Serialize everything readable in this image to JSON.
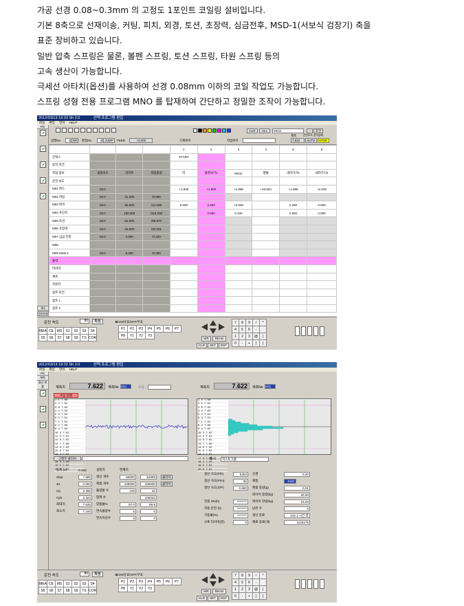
{
  "intro": [
    "가공 선경 0.08~0.3mm 의 고정도 1포인트 코일링 설비입니다.",
    "기본 8축으로 선재이송, 커팅, 피치, 외경, 토션, 초장력, 심금전후, MSD-1(서보식 검장기) 축을",
    "표준 장비하고 있습니다.",
    "일반 압축 스프링은 물론, 볼펜 스프링, 토션 스프링, 타원 스프링 등의",
    "고속 생산이 가능합니다.",
    "극세선 아타치(옵션)를 사용하여 선경 0.08mm 이하의 코일 작업도 가능합니다.",
    "스프링 성형 전용 프로그램 MNO 를 탑재하여 간단하고 정밀한 조작이 가능합니다."
  ],
  "shot1": {
    "title": [
      "2012/03/13 19:23  Sh 3.0",
      "선택 프로그램 편집"
    ],
    "menu": [
      "파일",
      "편집",
      "언어",
      "HELP"
    ],
    "sidebar_top": "PG",
    "side_items": [
      "",
      "",
      "",
      "",
      "",
      ""
    ],
    "side_btn": [
      "계속",
      "정지현재"
    ],
    "toolbar": {
      "jisilno_label": "실행No",
      "jisilno_val": "1",
      "nr": "NR",
      "pyeonjip_label": "편집No",
      "pyeonjip_val": "2",
      "jump": "JUMP",
      "feed_label": "FEED",
      "feed_val": "+0.000",
      "gyeisu_label": "기계위치",
      "jakeop_label": "작업위치",
      "clr": "CLR",
      "all": "ALL",
      "select": "MS11",
      "gyesu": "계측",
      "gyesu_val": "7.622",
      "auto": "AUTO",
      "stop": "STOP",
      "joyeon": "조건",
      "mode_label": "운전모드 동작상태"
    },
    "col_headers": [
      "",
      "",
      "",
      "",
      "1",
      "2",
      "3",
      "4",
      "5",
      "6"
    ],
    "row0": [
      "",
      "설정속도",
      "리미트",
      "작업원점"
    ],
    "rows": [
      {
        "label": "인덱스",
        "s": "",
        "l": "",
        "o": "",
        "c": [
          "START",
          "",
          "",
          "",
          "",
          ""
        ]
      },
      {
        "label": "동작 조건",
        "s": "",
        "l": "",
        "o": "",
        "c": [
          "",
          "",
          "",
          "",
          "",
          ""
        ]
      },
      {
        "label": "작업 정보",
        "s": "설정속도",
        "l": "리미트",
        "o": "작업원점",
        "c": [
          "라",
          "풀라되기1",
          "MS11",
          "평통",
          "내려가기1",
          "내려가기2"
        ]
      },
      {
        "label": "운전 속도",
        "s": "",
        "l": "",
        "o": "",
        "c": [
          "",
          "",
          "",
          "",
          "",
          ""
        ]
      },
      {
        "label": "M01 피드",
        "s": "50.0",
        "l": "",
        "o": "",
        "c": [
          "+1.500",
          "+1.800",
          "+1.898",
          "+43.504",
          "+1.898",
          "+2.029"
        ]
      },
      {
        "label": "M02 커팅",
        "s": "50.0",
        "l": "31.285",
        "o": "/0.000",
        "c": [
          "",
          "",
          "",
          "",
          "",
          ""
        ]
      },
      {
        "label": "M03 피치",
        "s": "50.0",
        "l": "35.000",
        "o": "/14.199",
        "c": [
          "0.000",
          "2.450",
          ">4.029",
          "",
          "2.450",
          "0.000"
        ]
      },
      {
        "label": "M04 포인트",
        "s": "50.0",
        "l": "180.000",
        "o": "/116.000",
        "c": [
          "",
          "0.050",
          "0.100",
          "",
          "0.050",
          "0.000"
        ]
      },
      {
        "label": "M05 토션",
        "s": "50.0",
        "l": "91.000",
        "o": "/90.970",
        "c": [
          "",
          "",
          "",
          "",
          "",
          ""
        ]
      },
      {
        "label": "M06 초장력",
        "s": "50.0",
        "l": "45.000",
        "o": "/22.001",
        "c": [
          "",
          "",
          "",
          "",
          "",
          ""
        ]
      },
      {
        "label": "M07 심금 전후",
        "s": "50.0",
        "l": "4.000",
        "o": "/0.400",
        "c": [
          "",
          "",
          "",
          "",
          "",
          ""
        ]
      },
      {
        "label": "M08",
        "s": "",
        "l": "",
        "o": "",
        "c": [
          "",
          "",
          "",
          "",
          "",
          ""
        ]
      },
      {
        "label": "M09 MSD-1",
        "s": "50.0",
        "l": "5.000",
        "o": "/0.000",
        "c": [
          "",
          "",
          "",
          "",
          "",
          ""
        ]
      },
      {
        "label": "출력",
        "s": "",
        "l": "",
        "o": "",
        "c": [
          "",
          "",
          "",
          "",
          "",
          ""
        ]
      },
      {
        "label": "타이머",
        "s": "",
        "l": "",
        "o": "",
        "c": [
          "",
          "",
          "",
          "",
          "",
          ""
        ]
      },
      {
        "label": "계측",
        "s": "",
        "l": "",
        "o": "",
        "c": [
          "",
          "",
          "",
          "",
          "",
          ""
        ]
      },
      {
        "label": "카운터",
        "s": "",
        "l": "",
        "o": "",
        "c": [
          "",
          "",
          "",
          "",
          "",
          ""
        ]
      },
      {
        "label": "점프 조건",
        "s": "",
        "l": "",
        "o": "",
        "c": [
          "",
          "",
          "",
          "",
          "",
          ""
        ]
      },
      {
        "label": "점프 1",
        "s": "",
        "l": "",
        "o": "",
        "c": [
          "",
          "",
          "",
          "",
          "",
          ""
        ]
      },
      {
        "label": "점프 2",
        "s": "",
        "l": "",
        "o": "",
        "c": [
          "",
          "",
          "",
          "",
          "",
          ""
        ]
      }
    ],
    "speed_label": "운전 속도",
    "speed_val": "80",
    "confirm": "확정",
    "onoff": "ON/유효/OFF/무효",
    "axis_rows": [
      [
        "MEA",
        "CE",
        "MS",
        "S1",
        "S2",
        "S3",
        "S4"
      ],
      [
        "S5",
        "S6",
        "S7",
        "S8",
        "S9",
        "TS",
        "COR"
      ]
    ],
    "p_rows": [
      [
        "P1",
        "P2",
        "P3",
        "P4",
        "P5",
        "P6",
        "P7"
      ],
      [
        "P8",
        "Y1",
        "Y2",
        "Y3",
        "",
        "",
        ""
      ]
    ],
    "jog": [
      "WR",
      "READ",
      "CLR",
      "SET",
      "RST"
    ],
    "keys": [
      [
        "7",
        "8",
        "9",
        "/",
        "*"
      ],
      [
        "4",
        "5",
        "6",
        "-",
        ""
      ],
      [
        "1",
        "2",
        "3",
        "@",
        "|"
      ],
      [
        "0",
        "-",
        "+",
        "]",
        "["
      ]
    ]
  },
  "shot2": {
    "title": [
      "2012/03/13 19:22  Sh 3.0",
      "선택 프로그램 편집"
    ],
    "menu": [
      "파일",
      "편집",
      "언어",
      "HELP"
    ],
    "side_top": [
      "PG",
      "계측",
      "결산 현황"
    ],
    "m1_label": "계측치",
    "m1_val": "7.622",
    "m1_no_label": "계측No",
    "m1_no": "M11",
    "m1_extra": "수동",
    "m2_label": "계측치",
    "m2_val": "7.622",
    "m2_no_label": "계측No",
    "m2_no": "M11",
    "manual_btn": "수동 실행",
    "graph_clear": "그래프 클리어",
    "display_label": "표시",
    "display_val": "히스토그램",
    "list1": [
      "1 1 7.60",
      "2 4 7.61",
      "3 6 7.62",
      "4 4 7.62",
      "5 2 7.61",
      "6 3 7.61",
      "7 1 7.61",
      "8 2 7.60",
      "9 4 7.62",
      "10 3 7.62",
      "11 5 7.61",
      "12 6 7.61",
      "13 7 7.60",
      "14 8 7.62",
      "15 9 7.62",
      "16 2 7.61",
      "17 3 7.60",
      "18 4 7.60",
      "19 5 7.61",
      "20 6 7.61"
    ],
    "list2": [
      "1 4 7.60",
      "2 5 7.61",
      "3 6 7.62",
      "4 4 7.62",
      "5 2 7.61",
      "6 3 7.61",
      "7 1 7.61",
      "8 2 7.60",
      "9 4 7.62",
      "10 3 7.62",
      "11 5 7.61",
      "12 6 7.61",
      "13 7 7.60",
      "14 8 7.62",
      "15 9 7.62",
      "16 2 7.61",
      "17 3 7.60",
      "18 4 7.60",
      "19 5 7.61",
      "20 6 7.61"
    ],
    "stats_left": [
      [
        "공차 (±)",
        "0.150",
        "설정치",
        "현재치"
      ],
      [
        "Xbar",
        "7.596",
        "생산 개수",
        "60000",
        "54999",
        "클리어"
      ],
      [
        "3σ",
        "0.063",
        "제품 개수",
        "105000",
        "105000",
        "클리어"
      ],
      [
        "Cp",
        "2.366",
        "불량품 수",
        "100",
        "22",
        ""
      ],
      [
        "Cpk",
        "2.323",
        "합계 수",
        "",
        "105022",
        ""
      ],
      [
        "최대치",
        "7.645",
        "양품율%",
        "97.0",
        "99.9",
        ""
      ],
      [
        "최소치",
        "7.160",
        "연속불량수",
        "5",
        "0",
        ""
      ],
      [
        "",
        "",
        "연속이상수",
        "5",
        "0",
        ""
      ]
    ],
    "stats_right": [
      [
        "생산 속도(P/h)",
        "5454",
        "선경",
        "0.20"
      ],
      [
        "생산 속도(P/m)",
        "90",
        "재질",
        "SWC"
      ],
      [
        "생산 속도(S/P)",
        "0.660",
        "제품 중량(g)",
        "0.01"
      ],
      [
        "",
        "",
        "와이어 중량(kg)",
        "20.00"
      ],
      [
        "전원 ON(h)",
        "********",
        "와이어 잔량(kg)",
        "16.53"
      ],
      [
        "자동 운전 (h)",
        "********",
        "남은 수",
        "0"
      ],
      [
        "가동율(%)",
        "********",
        "생산 종료",
        "242.1  시간 후"
      ],
      [
        "오토 타이머(분)",
        "0",
        "재료 종료(개)",
        "1120176"
      ]
    ],
    "speed_label": "운전 속도",
    "speed_val": "80",
    "confirm": "확정",
    "onoff": "ON/유효/OFF/무효",
    "axis_rows": [
      [
        "MEA",
        "CE",
        "MS",
        "S1",
        "S2",
        "S3",
        "S4"
      ],
      [
        "S5",
        "S6",
        "S7",
        "S8",
        "S9",
        "TS",
        "COR"
      ]
    ],
    "p_rows": [
      [
        "P1",
        "P2",
        "P3",
        "P4",
        "P5",
        "P6",
        "P7"
      ],
      [
        "P8",
        "Y1",
        "Y2",
        "Y3",
        "",
        "",
        ""
      ]
    ],
    "jog": [
      "WR",
      "READ",
      "CLR",
      "SET",
      "RST"
    ],
    "keys": [
      [
        "7",
        "8",
        "9",
        "/",
        "*"
      ],
      [
        "4",
        "5",
        "6",
        "-",
        ""
      ],
      [
        "1",
        "2",
        "3",
        "@",
        "|"
      ],
      [
        "0",
        "-",
        "+",
        "]",
        "["
      ]
    ]
  },
  "colors": {
    "pink": "#ff99ff",
    "gray": "#a6a59e",
    "accent": "#1f3fae"
  }
}
